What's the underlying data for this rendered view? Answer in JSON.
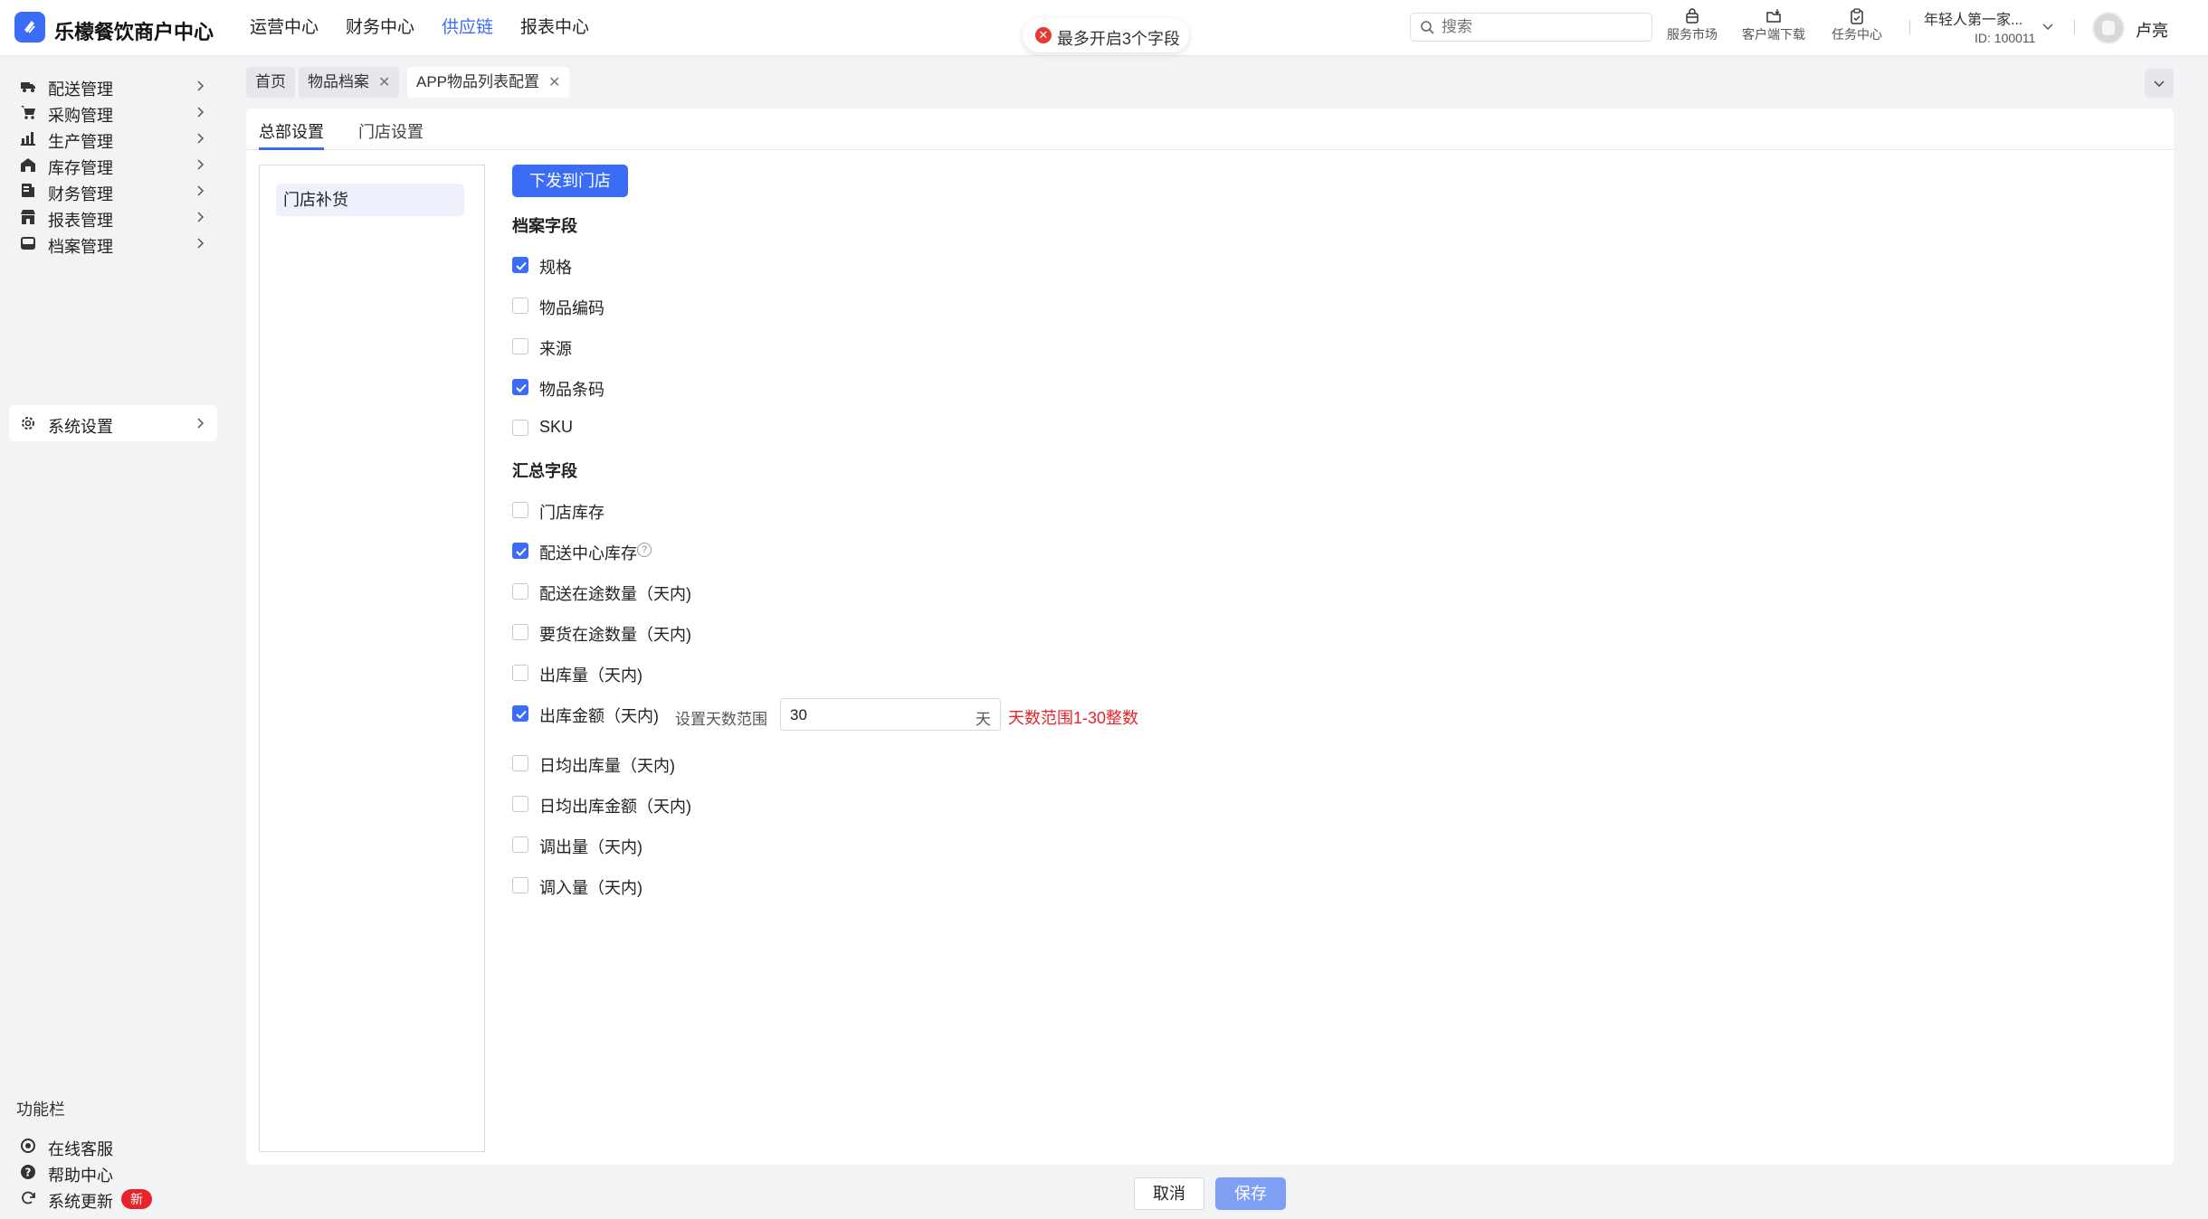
{
  "brand": "乐檬餐饮商户中心",
  "topnav": [
    {
      "label": "运营中心",
      "active": false
    },
    {
      "label": "财务中心",
      "active": false
    },
    {
      "label": "供应链",
      "active": true
    },
    {
      "label": "报表中心",
      "active": false
    }
  ],
  "toast": {
    "text": "最多开启3个字段",
    "icon": "error-icon"
  },
  "search": {
    "placeholder": "搜索"
  },
  "tools": {
    "market": "服务市场",
    "download": "客户端下载",
    "tasks": "任务中心"
  },
  "store": {
    "name": "年轻人第一家...",
    "id": "ID: 100011"
  },
  "user": {
    "name": "卢亮"
  },
  "sidebar": {
    "items": [
      {
        "label": "配送管理",
        "icon": "truck-icon"
      },
      {
        "label": "采购管理",
        "icon": "cart-icon"
      },
      {
        "label": "生产管理",
        "icon": "factory-icon"
      },
      {
        "label": "库存管理",
        "icon": "warehouse-icon"
      },
      {
        "label": "财务管理",
        "icon": "ledger-icon"
      },
      {
        "label": "报表管理",
        "icon": "store-icon"
      },
      {
        "label": "档案管理",
        "icon": "archive-icon"
      },
      {
        "label": "系统设置",
        "icon": "gear-icon"
      }
    ],
    "func_title": "功能栏",
    "func_items": [
      {
        "label": "在线客服",
        "icon": "headset-icon"
      },
      {
        "label": "帮助中心",
        "icon": "help-icon"
      },
      {
        "label": "系统更新",
        "icon": "refresh-icon",
        "badge": "新"
      }
    ]
  },
  "tabs": [
    {
      "label": "首页",
      "closable": false
    },
    {
      "label": "物品档案",
      "closable": true
    },
    {
      "label": "APP物品列表配置",
      "closable": true
    }
  ],
  "subtabs": [
    {
      "label": "总部设置",
      "active": true
    },
    {
      "label": "门店设置",
      "active": false
    }
  ],
  "left_list": [
    "门店补货"
  ],
  "push_button": "下发到门店",
  "archive_section": {
    "title": "档案字段",
    "fields": [
      {
        "label": "规格",
        "checked": true
      },
      {
        "label": "物品编码",
        "checked": false
      },
      {
        "label": "来源",
        "checked": false
      },
      {
        "label": "物品条码",
        "checked": true
      },
      {
        "label": "SKU",
        "checked": false
      }
    ]
  },
  "summary_section": {
    "title": "汇总字段",
    "fields": [
      {
        "label": "门店库存",
        "checked": false
      },
      {
        "label": "配送中心库存",
        "checked": true
      },
      {
        "label": "配送在途数量（天内)",
        "checked": false
      },
      {
        "label": "要货在途数量（天内)",
        "checked": false
      },
      {
        "label": "出库量（天内)",
        "checked": false
      },
      {
        "label": "出库金额（天内)",
        "checked": true
      },
      {
        "label": "日均出库量（天内)",
        "checked": false
      },
      {
        "label": "日均出库金额（天内)",
        "checked": false
      },
      {
        "label": "调出量（天内)",
        "checked": false
      },
      {
        "label": "调入量（天内)",
        "checked": false
      }
    ]
  },
  "range": {
    "label": "设置天数范围",
    "value": "30",
    "unit": "天",
    "hint": "天数范围1-30整数"
  },
  "footer": {
    "cancel": "取消",
    "save": "保存"
  },
  "colors": {
    "accent": "#3b6cf6",
    "error": "#e8242b",
    "save_disabled": "#7f9ff5"
  }
}
